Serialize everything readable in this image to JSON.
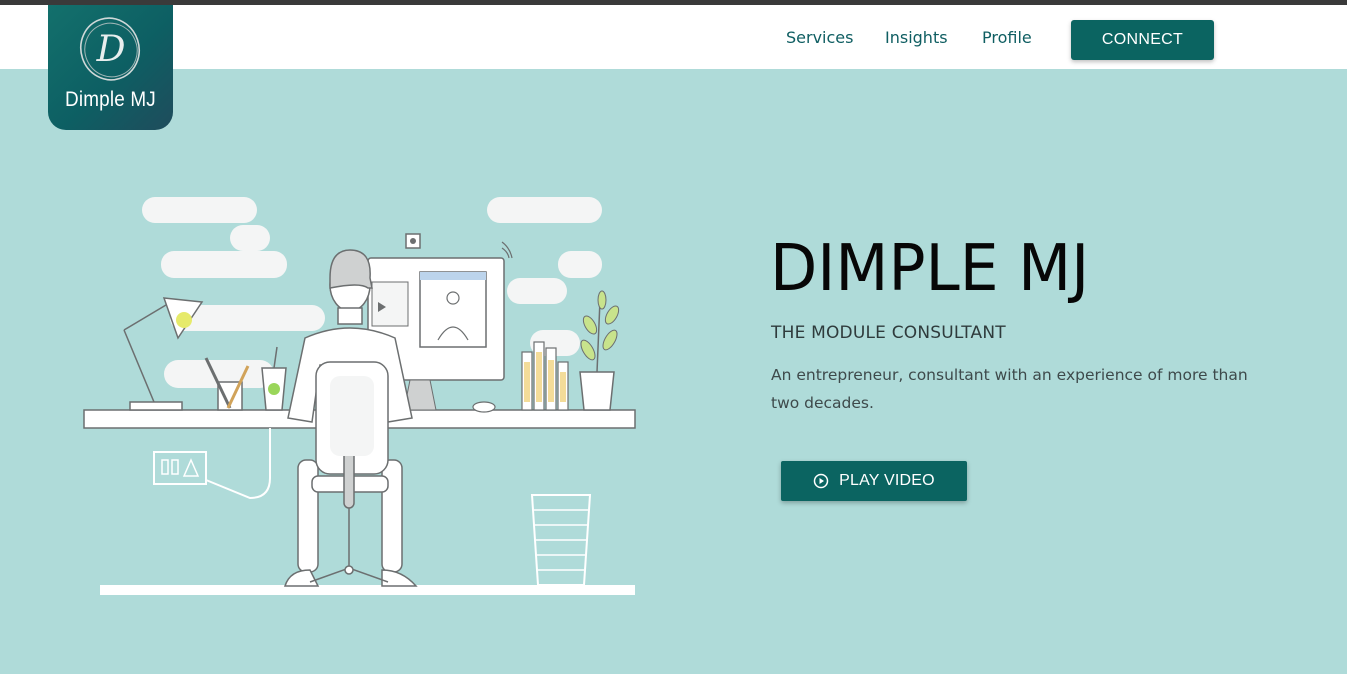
{
  "brand": {
    "logo_text": "Dimple MJ",
    "logo_letter": "D"
  },
  "nav": {
    "items": [
      {
        "label": "Services"
      },
      {
        "label": "Insights"
      },
      {
        "label": "Profile"
      }
    ],
    "cta_label": "CONNECT"
  },
  "hero": {
    "title": "DIMPLE MJ",
    "subtitle": "THE MODULE CONSULTANT",
    "description": "An entrepreneur, consultant with an experience of more than two decades.",
    "play_label": "PLAY VIDEO"
  },
  "colors": {
    "background": "#afdbd9",
    "primary": "#0b6461",
    "nav_text": "#0f5e62",
    "header": "#ffffff"
  },
  "icons": {
    "play": "play-circle-icon",
    "illustration": "person-at-desk-illustration"
  }
}
